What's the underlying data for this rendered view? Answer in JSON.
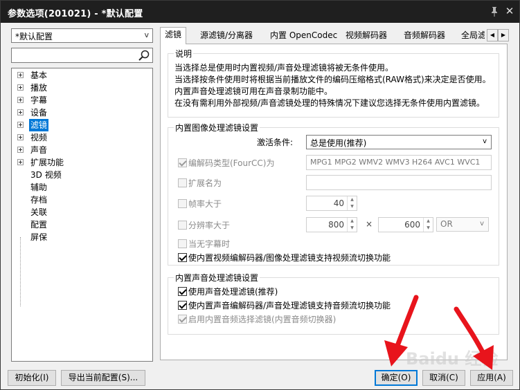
{
  "window": {
    "title": "参数选项(201021) - *默认配置"
  },
  "sidebar": {
    "profile_value": "*默认配置",
    "search_placeholder": "",
    "tree": [
      {
        "label": "基本",
        "expandable": true,
        "selected": false
      },
      {
        "label": "播放",
        "expandable": true,
        "selected": false
      },
      {
        "label": "字幕",
        "expandable": true,
        "selected": false
      },
      {
        "label": "设备",
        "expandable": true,
        "selected": false
      },
      {
        "label": "滤镜",
        "expandable": true,
        "selected": true
      },
      {
        "label": "视频",
        "expandable": true,
        "selected": false
      },
      {
        "label": "声音",
        "expandable": true,
        "selected": false
      },
      {
        "label": "扩展功能",
        "expandable": true,
        "selected": false
      },
      {
        "label": "3D 视频",
        "expandable": false,
        "selected": false
      },
      {
        "label": "辅助",
        "expandable": false,
        "selected": false
      },
      {
        "label": "存档",
        "expandable": false,
        "selected": false
      },
      {
        "label": "关联",
        "expandable": false,
        "selected": false
      },
      {
        "label": "配置",
        "expandable": false,
        "selected": false
      },
      {
        "label": "屏保",
        "expandable": false,
        "selected": false
      }
    ]
  },
  "tabs": [
    {
      "label": "滤镜",
      "active": true
    },
    {
      "label": "源滤镜/分离器",
      "active": false
    },
    {
      "label": "内置 OpenCodec",
      "active": false
    },
    {
      "label": "视频解码器",
      "active": false
    },
    {
      "label": "音频解码器",
      "active": false
    },
    {
      "label": "全局滤",
      "active": false
    }
  ],
  "description": {
    "title": "说明",
    "text": "当选择总是使用时内置视频/声音处理滤镜将被无条件使用。\n当选择按条件使用时将根据当前播放文件的编码压缩格式(RAW格式)来决定是否使用。内置声音处理滤镜可用在声音录制功能中。\n在没有需利用外部视频/声音滤镜处理的特殊情况下建议您选择无条件使用内置滤镜。"
  },
  "image_filter": {
    "title": "内置图像处理滤镜设置",
    "activation_label": "激活条件:",
    "activation_value": "总是使用(推荐)",
    "fourcc_label": "编解码类型(FourCC)为",
    "fourcc_checked": true,
    "fourcc_value": "MPG1 MPG2 WMV2 WMV3 H264 AVC1 WVC1",
    "ext_label": "扩展名为",
    "ext_checked": false,
    "ext_value": "",
    "framerate_label": "帧率大于",
    "framerate_checked": false,
    "framerate_value": "40",
    "resolution_label": "分辨率大于",
    "resolution_checked": false,
    "res_w": "800",
    "res_x": "×",
    "res_h": "600",
    "res_op": "OR",
    "nosub_label": "当无字幕时",
    "nosub_checked": false,
    "stream_switch_label": "使内置视频编解码器/图像处理滤镜支持视频流切换功能",
    "stream_switch_checked": true
  },
  "audio_filter": {
    "title": "内置声音处理滤镜设置",
    "use_label": "使用声音处理滤镜(推荐)",
    "use_checked": true,
    "switch_label": "使内置声音编解码器/声音处理滤镜支持音频流切换功能",
    "switch_checked": true,
    "selector_label": "启用内置音频选择滤镜(内置音频切换器)",
    "selector_checked": true
  },
  "footer": {
    "init_label": "初始化(I)",
    "export_label": "导出当前配置(S)...",
    "ok_label": "确定(O)",
    "cancel_label": "取消(C)",
    "apply_label": "应用(A)"
  },
  "overlay": {
    "watermark": "Baidu 经验",
    "arrow_color": "#e8141c"
  }
}
